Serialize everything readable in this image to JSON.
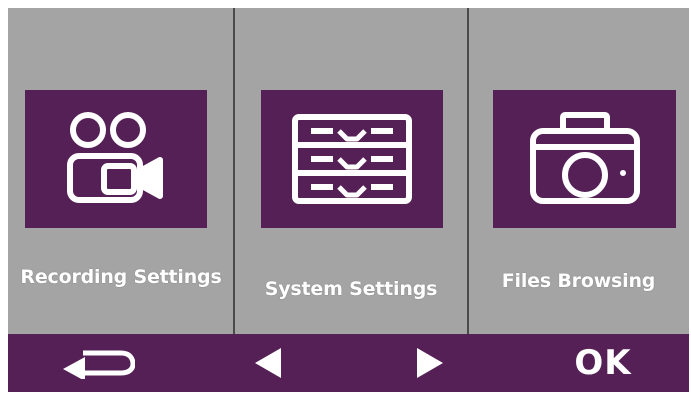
{
  "menu": {
    "items": [
      {
        "label": "Recording Settings",
        "icon": "video-camera-icon"
      },
      {
        "label": "System Settings",
        "icon": "drawer-cabinet-icon"
      },
      {
        "label": "Files Browsing",
        "icon": "photo-camera-icon"
      }
    ]
  },
  "nav": {
    "back_icon": "return-arrow-icon",
    "prev_icon": "left-triangle-icon",
    "next_icon": "right-triangle-icon",
    "ok_label": "OK"
  },
  "colors": {
    "panel_background": "#a4a4a4",
    "accent_purple": "#552055",
    "divider": "#4a4a4a",
    "text": "#ffffff"
  }
}
